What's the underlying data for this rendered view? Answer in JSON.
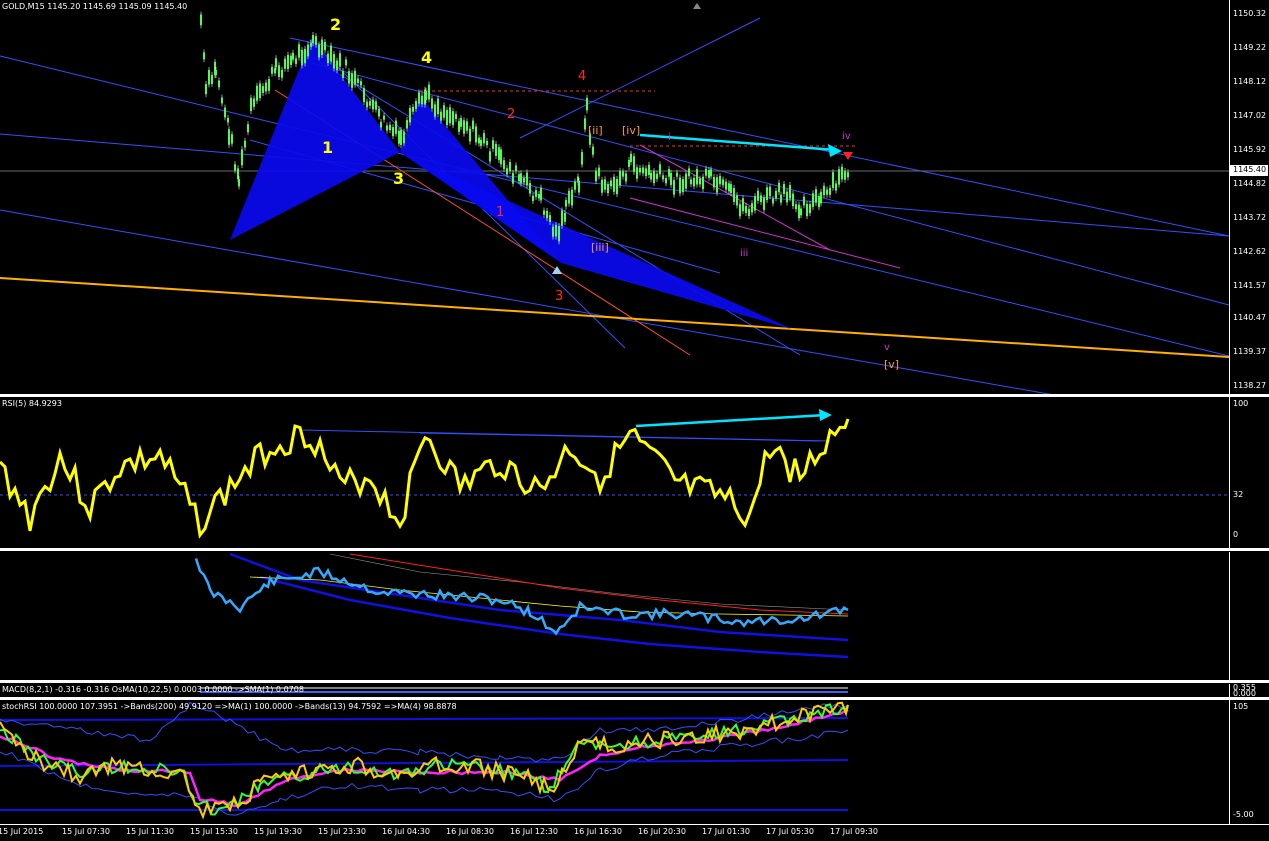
{
  "main": {
    "label": "GOLD,M15  1145.20 1145.69 1145.09 1145.40",
    "current_price": "1145.40",
    "price_ticks": [
      "1150.32",
      "1149.22",
      "1148.12",
      "1147.02",
      "1145.92",
      "1144.82",
      "1143.72",
      "1142.62",
      "1141.57",
      "1140.47",
      "1139.37",
      "1138.27"
    ],
    "wave_labels": {
      "y1": "1",
      "y2": "2",
      "y3": "3",
      "y4": "4",
      "r1": "1",
      "r2": "2",
      "r3": "3",
      "r4": "4",
      "ii": "[ii]",
      "iii_b": "[iii]",
      "iv_b": "[iv]",
      "v_b": "[v]",
      "i_s": "i",
      "iii_s": "iii",
      "iv_s": "iv",
      "v_s": "v"
    },
    "colors": {
      "bull": "#00ff00",
      "pattern": "#0000ff",
      "arrow": "#00ffff",
      "ma": "#ffcc00"
    }
  },
  "rsi": {
    "label": "RSI(5) 84.9293",
    "ticks": [
      "100",
      "32",
      "0"
    ]
  },
  "panel3": {},
  "macd": {
    "label": "MACD(8,2,1) -0.316 -0.316  OsMA(10,22,5) 0.0003 0.0000  ->SMA(1) 0.0708",
    "ticks": [
      "0.355",
      "0.000"
    ]
  },
  "stoch": {
    "label": "stochRSI 100.0000 107.3951  ->Bands(200) 49.9120  =>MA(1) 100.0000  ->Bands(13) 94.7592  =>MA(4) 98.8878",
    "ticks": [
      "105",
      "-5.00"
    ]
  },
  "time_labels": [
    "15 Jul 2015",
    "15 Jul 07:30",
    "15 Jul 11:30",
    "15 Jul 15:30",
    "15 Jul 19:30",
    "15 Jul 23:30",
    "16 Jul 04:30",
    "16 Jul 08:30",
    "16 Jul 12:30",
    "16 Jul 16:30",
    "16 Jul 20:30",
    "17 Jul 01:30",
    "17 Jul 05:30",
    "17 Jul 09:30"
  ]
}
